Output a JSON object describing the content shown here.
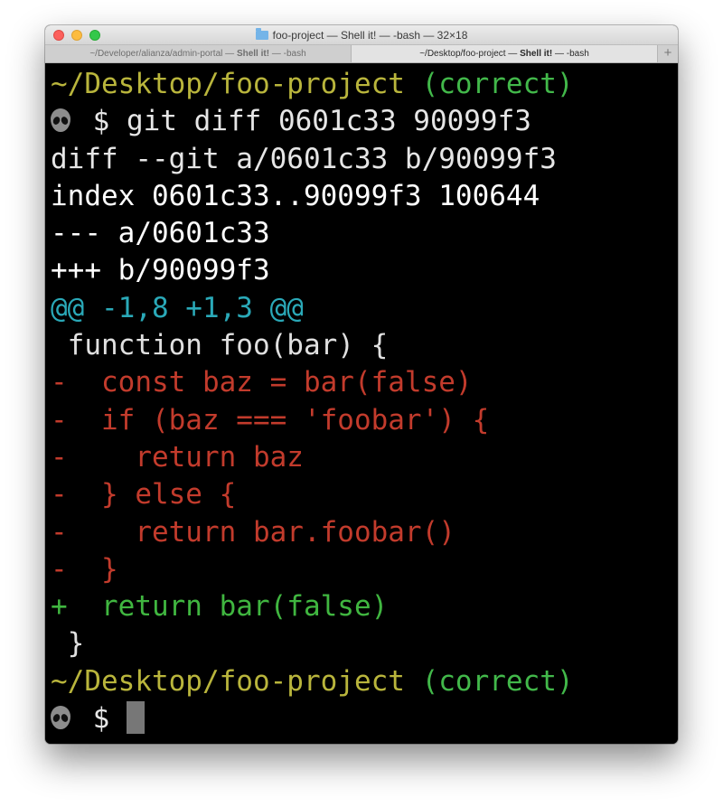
{
  "window": {
    "title": "foo-project — Shell it! — -bash — 32×18"
  },
  "tabs": [
    {
      "path": "~/Developer/alianza/admin-portal — ",
      "app": "Shell it!",
      "suffix": " — -bash"
    },
    {
      "path": "~/Desktop/foo-project — ",
      "app": "Shell it!",
      "suffix": " — -bash"
    }
  ],
  "add_tab_label": "+",
  "terminal": {
    "prompt1": {
      "path": "~/Desktop/foo-project",
      "branch": "(correct)"
    },
    "command": "$ git diff 0601c33 90099f3",
    "header_lines": [
      "diff --git a/0601c33 b/90099f3",
      "index 0601c33..90099f3 100644",
      "--- a/0601c33",
      "+++ b/90099f3"
    ],
    "hunk": "@@ -1,8 +1,3 @@",
    "context_first": " function foo(bar) {",
    "removed_lines": [
      "-  const baz = bar(false)",
      "-  if (baz === 'foobar') {",
      "-    return baz",
      "-  } else {",
      "-    return bar.foobar()",
      "-  }"
    ],
    "added_line": "+  return bar(false)",
    "context_last": " }",
    "prompt2": {
      "path": "~/Desktop/foo-project",
      "branch": "(correct)"
    },
    "input_prompt": "$"
  },
  "colors": {
    "path": "#b9b53c",
    "branch": "#42b84a",
    "hunk": "#2aa9b8",
    "removed": "#c23b2c",
    "added": "#40b640",
    "background": "#000000"
  }
}
